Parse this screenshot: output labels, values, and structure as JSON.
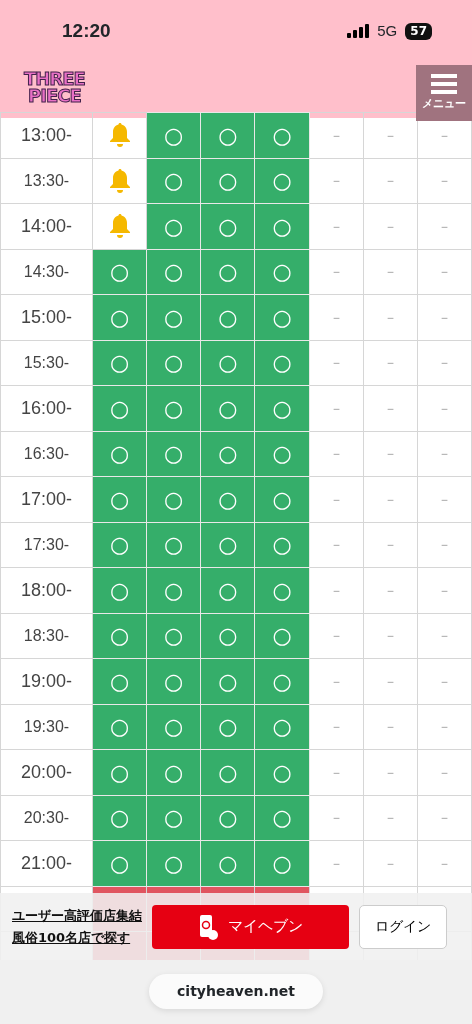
{
  "status_bar": {
    "time": "12:20",
    "network": "5G",
    "battery": "57"
  },
  "header": {
    "logo_lines": [
      "THREE",
      "PIECE"
    ],
    "menu_label": "メニュー"
  },
  "schedule": {
    "rows": [
      {
        "time": "13:00-",
        "cells": [
          {
            "kind": "bell"
          },
          {
            "kind": "open",
            "text": "○"
          },
          {
            "kind": "open",
            "text": "○"
          },
          {
            "kind": "open",
            "text": "○"
          },
          {
            "kind": "closed",
            "text": "－"
          },
          {
            "kind": "closed",
            "text": "－"
          },
          {
            "kind": "closed",
            "text": "－"
          }
        ]
      },
      {
        "time": "13:30-",
        "cells": [
          {
            "kind": "bell"
          },
          {
            "kind": "open",
            "text": "○"
          },
          {
            "kind": "open",
            "text": "○"
          },
          {
            "kind": "open",
            "text": "○"
          },
          {
            "kind": "closed",
            "text": "－"
          },
          {
            "kind": "closed",
            "text": "－"
          },
          {
            "kind": "closed",
            "text": "－"
          }
        ]
      },
      {
        "time": "14:00-",
        "cells": [
          {
            "kind": "bell"
          },
          {
            "kind": "open",
            "text": "○"
          },
          {
            "kind": "open",
            "text": "○"
          },
          {
            "kind": "open",
            "text": "○"
          },
          {
            "kind": "closed",
            "text": "－"
          },
          {
            "kind": "closed",
            "text": "－"
          },
          {
            "kind": "closed",
            "text": "－"
          }
        ]
      },
      {
        "time": "14:30-",
        "cells": [
          {
            "kind": "open",
            "text": "○"
          },
          {
            "kind": "open",
            "text": "○"
          },
          {
            "kind": "open",
            "text": "○"
          },
          {
            "kind": "open",
            "text": "○"
          },
          {
            "kind": "closed",
            "text": "－"
          },
          {
            "kind": "closed",
            "text": "－"
          },
          {
            "kind": "closed",
            "text": "－"
          }
        ]
      },
      {
        "time": "15:00-",
        "cells": [
          {
            "kind": "open",
            "text": "○"
          },
          {
            "kind": "open",
            "text": "○"
          },
          {
            "kind": "open",
            "text": "○"
          },
          {
            "kind": "open",
            "text": "○"
          },
          {
            "kind": "closed",
            "text": "－"
          },
          {
            "kind": "closed",
            "text": "－"
          },
          {
            "kind": "closed",
            "text": "－"
          }
        ]
      },
      {
        "time": "15:30-",
        "cells": [
          {
            "kind": "open",
            "text": "○"
          },
          {
            "kind": "open",
            "text": "○"
          },
          {
            "kind": "open",
            "text": "○"
          },
          {
            "kind": "open",
            "text": "○"
          },
          {
            "kind": "closed",
            "text": "－"
          },
          {
            "kind": "closed",
            "text": "－"
          },
          {
            "kind": "closed",
            "text": "－"
          }
        ]
      },
      {
        "time": "16:00-",
        "cells": [
          {
            "kind": "open",
            "text": "○"
          },
          {
            "kind": "open",
            "text": "○"
          },
          {
            "kind": "open",
            "text": "○"
          },
          {
            "kind": "open",
            "text": "○"
          },
          {
            "kind": "closed",
            "text": "－"
          },
          {
            "kind": "closed",
            "text": "－"
          },
          {
            "kind": "closed",
            "text": "－"
          }
        ]
      },
      {
        "time": "16:30-",
        "cells": [
          {
            "kind": "open",
            "text": "○"
          },
          {
            "kind": "open",
            "text": "○"
          },
          {
            "kind": "open",
            "text": "○"
          },
          {
            "kind": "open",
            "text": "○"
          },
          {
            "kind": "closed",
            "text": "－"
          },
          {
            "kind": "closed",
            "text": "－"
          },
          {
            "kind": "closed",
            "text": "－"
          }
        ]
      },
      {
        "time": "17:00-",
        "cells": [
          {
            "kind": "open",
            "text": "○"
          },
          {
            "kind": "open",
            "text": "○"
          },
          {
            "kind": "open",
            "text": "○"
          },
          {
            "kind": "open",
            "text": "○"
          },
          {
            "kind": "closed",
            "text": "－"
          },
          {
            "kind": "closed",
            "text": "－"
          },
          {
            "kind": "closed",
            "text": "－"
          }
        ]
      },
      {
        "time": "17:30-",
        "cells": [
          {
            "kind": "open",
            "text": "○"
          },
          {
            "kind": "open",
            "text": "○"
          },
          {
            "kind": "open",
            "text": "○"
          },
          {
            "kind": "open",
            "text": "○"
          },
          {
            "kind": "closed",
            "text": "－"
          },
          {
            "kind": "closed",
            "text": "－"
          },
          {
            "kind": "closed",
            "text": "－"
          }
        ]
      },
      {
        "time": "18:00-",
        "cells": [
          {
            "kind": "open",
            "text": "○"
          },
          {
            "kind": "open",
            "text": "○"
          },
          {
            "kind": "open",
            "text": "○"
          },
          {
            "kind": "open",
            "text": "○"
          },
          {
            "kind": "closed",
            "text": "－"
          },
          {
            "kind": "closed",
            "text": "－"
          },
          {
            "kind": "closed",
            "text": "－"
          }
        ]
      },
      {
        "time": "18:30-",
        "cells": [
          {
            "kind": "open",
            "text": "○"
          },
          {
            "kind": "open",
            "text": "○"
          },
          {
            "kind": "open",
            "text": "○"
          },
          {
            "kind": "open",
            "text": "○"
          },
          {
            "kind": "closed",
            "text": "－"
          },
          {
            "kind": "closed",
            "text": "－"
          },
          {
            "kind": "closed",
            "text": "－"
          }
        ]
      },
      {
        "time": "19:00-",
        "cells": [
          {
            "kind": "open",
            "text": "○"
          },
          {
            "kind": "open",
            "text": "○"
          },
          {
            "kind": "open",
            "text": "○"
          },
          {
            "kind": "open",
            "text": "○"
          },
          {
            "kind": "closed",
            "text": "－"
          },
          {
            "kind": "closed",
            "text": "－"
          },
          {
            "kind": "closed",
            "text": "－"
          }
        ]
      },
      {
        "time": "19:30-",
        "cells": [
          {
            "kind": "open",
            "text": "○"
          },
          {
            "kind": "open",
            "text": "○"
          },
          {
            "kind": "open",
            "text": "○"
          },
          {
            "kind": "open",
            "text": "○"
          },
          {
            "kind": "closed",
            "text": "－"
          },
          {
            "kind": "closed",
            "text": "－"
          },
          {
            "kind": "closed",
            "text": "－"
          }
        ]
      },
      {
        "time": "20:00-",
        "cells": [
          {
            "kind": "open",
            "text": "○"
          },
          {
            "kind": "open",
            "text": "○"
          },
          {
            "kind": "open",
            "text": "○"
          },
          {
            "kind": "open",
            "text": "○"
          },
          {
            "kind": "closed",
            "text": "－"
          },
          {
            "kind": "closed",
            "text": "－"
          },
          {
            "kind": "closed",
            "text": "－"
          }
        ]
      },
      {
        "time": "20:30-",
        "cells": [
          {
            "kind": "open",
            "text": "○"
          },
          {
            "kind": "open",
            "text": "○"
          },
          {
            "kind": "open",
            "text": "○"
          },
          {
            "kind": "open",
            "text": "○"
          },
          {
            "kind": "closed",
            "text": "－"
          },
          {
            "kind": "closed",
            "text": "－"
          },
          {
            "kind": "closed",
            "text": "－"
          }
        ]
      },
      {
        "time": "21:00-",
        "cells": [
          {
            "kind": "open",
            "text": "○"
          },
          {
            "kind": "open",
            "text": "○"
          },
          {
            "kind": "open",
            "text": "○"
          },
          {
            "kind": "open",
            "text": "○"
          },
          {
            "kind": "closed",
            "text": "－"
          },
          {
            "kind": "closed",
            "text": "－"
          },
          {
            "kind": "closed",
            "text": "－"
          }
        ]
      },
      {
        "cells": [
          {
            "kind": "full"
          },
          {
            "kind": "full"
          },
          {
            "kind": "full"
          },
          {
            "kind": "full"
          },
          {
            "kind": "closed"
          },
          {
            "kind": "closed"
          },
          {
            "kind": "closed"
          }
        ]
      },
      {
        "cells": [
          {
            "kind": "full"
          },
          {
            "kind": "full"
          },
          {
            "kind": "full"
          },
          {
            "kind": "full"
          },
          {
            "kind": "closed"
          },
          {
            "kind": "closed"
          },
          {
            "kind": "closed"
          }
        ]
      }
    ]
  },
  "banner": {
    "link_lines": [
      "ユーザー高評価店集結",
      "風俗100名店で探す"
    ],
    "primary_button": "マイヘブン",
    "login_button": "ログイン"
  },
  "browser": {
    "url": "cityheaven.net"
  }
}
